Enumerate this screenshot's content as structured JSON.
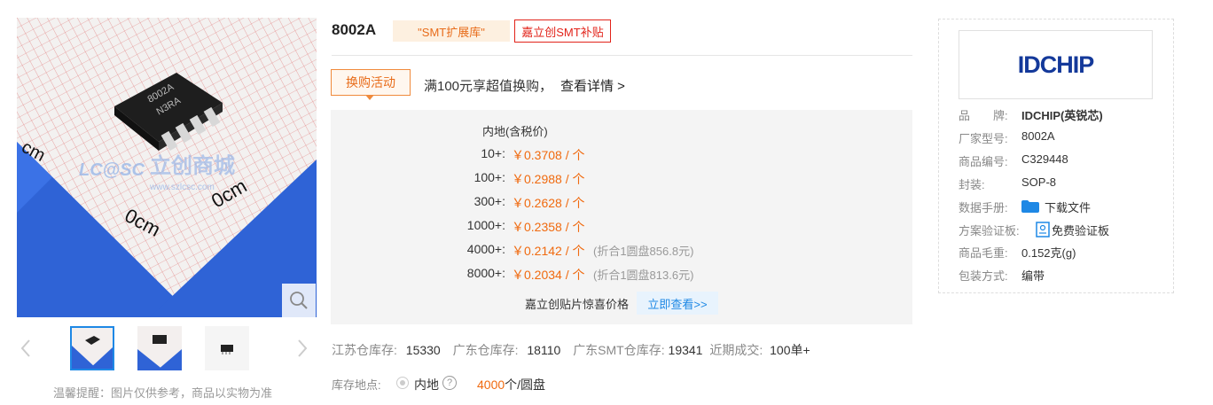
{
  "gallery": {
    "chip_marking_line1": "8002A",
    "chip_marking_line2": "N3RA",
    "watermark_brand": "LC@SC",
    "watermark_cn": "立创商城",
    "watermark_url": "www.szlcsc.com",
    "scale_label_1": "cm",
    "scale_label_2": "0cm",
    "scale_label_3": "0cm",
    "tip": "温馨提醒：图片仅供参考，商品以实物为准"
  },
  "product": {
    "title": "8002A",
    "tag_ext": "\"SMT扩展库\"",
    "tag_smt": "嘉立创SMT补贴",
    "promo_tag": "换购活动",
    "promo_text": "满100元享超值换购，",
    "promo_link": "查看详情 >",
    "price_header": "内地(含税价)",
    "prices": [
      {
        "qty": "10+:",
        "price": "￥0.3708 / 个",
        "note": ""
      },
      {
        "qty": "100+:",
        "price": "￥0.2988 / 个",
        "note": ""
      },
      {
        "qty": "300+:",
        "price": "￥0.2628 / 个",
        "note": ""
      },
      {
        "qty": "1000+:",
        "price": "￥0.2358 / 个",
        "note": ""
      },
      {
        "qty": "4000+:",
        "price": "￥0.2142 / 个",
        "note": "(折合1圆盘856.8元)"
      },
      {
        "qty": "8000+:",
        "price": "￥0.2034 / 个",
        "note": "(折合1圆盘813.6元)"
      }
    ],
    "surprise_text": "嘉立创贴片惊喜价格",
    "surprise_btn": "立即查看>>",
    "stock": {
      "js_label": "江苏仓库存:",
      "js_value": "15330",
      "gd_label": "广东仓库存:",
      "gd_value": "18110",
      "smt_label": "广东SMT仓库存:",
      "smt_value": "19341",
      "recent_label": "近期成交:",
      "recent_value": "100单+"
    },
    "location": {
      "label": "库存地点:",
      "value": "内地",
      "help": "?",
      "reel_num": "4000",
      "reel_unit": "个/圆盘"
    }
  },
  "specs": {
    "brand_logo_text": "IDCHIP",
    "rows": [
      {
        "k": "品　　牌:",
        "v": "IDCHIP(英锐芯)"
      },
      {
        "k": "厂家型号:",
        "v": "8002A"
      },
      {
        "k": "商品编号:",
        "v": "C329448"
      },
      {
        "k": "封装:",
        "v": "SOP-8"
      },
      {
        "k": "数据手册:",
        "v": "下载文件"
      },
      {
        "k": "方案验证板:",
        "v": "免费验证板"
      },
      {
        "k": "商品毛重:",
        "v": "0.152克(g)"
      },
      {
        "k": "包装方式:",
        "v": "编带"
      }
    ]
  },
  "colors": {
    "accent_orange": "#f06a0f",
    "accent_red": "#e2231a",
    "link_blue": "#1e88e5",
    "brand_navy": "#14399a"
  },
  "icons": [
    "search-icon",
    "chevron-left-icon",
    "chevron-right-icon",
    "folder-icon",
    "board-icon",
    "help-icon"
  ]
}
